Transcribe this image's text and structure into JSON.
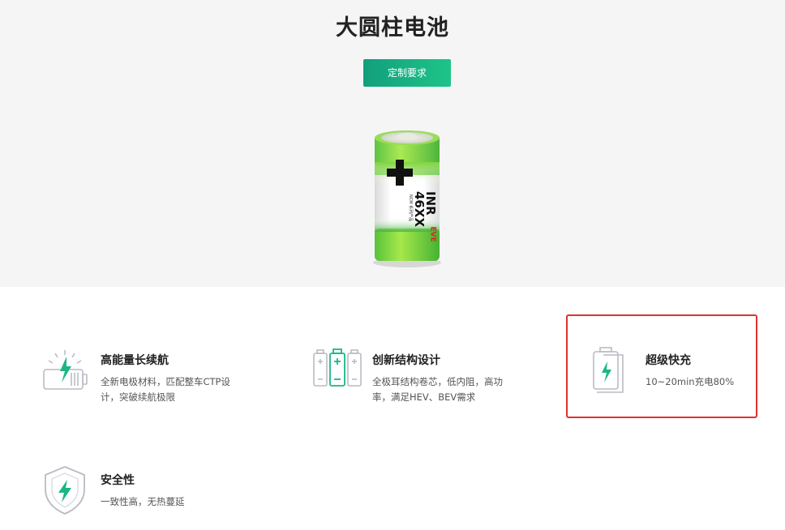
{
  "hero": {
    "title": "大圆柱电池",
    "cta_label": "定制要求",
    "battery": {
      "model": "INR 46XX",
      "sub_label": "NCM 系列产品",
      "brand": "EVE"
    }
  },
  "features": [
    {
      "title": "高能量长续航",
      "desc": "全新电极材料，匹配整车CTP设计，突破续航极限",
      "icon": "battery-energy-icon"
    },
    {
      "title": "创新结构设计",
      "desc": "全极耳结构卷芯，低内阻，高功率，满足HEV、BEV需求",
      "icon": "battery-structure-icon"
    },
    {
      "title": "超级快充",
      "desc": "10~20min充电80%",
      "icon": "fast-charge-icon"
    },
    {
      "title": "安全性",
      "desc": "一致性高，无热蔓延",
      "icon": "shield-bolt-icon"
    }
  ],
  "colors": {
    "accent": "#1bb686",
    "highlight_border": "#e0312d"
  }
}
